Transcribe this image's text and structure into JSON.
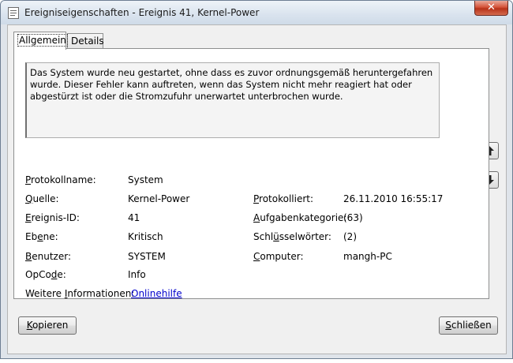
{
  "window": {
    "title": "Ereigniseigenschaften - Ereignis 41, Kernel-Power",
    "close_glyph": "✕"
  },
  "tabs": [
    {
      "label": "Allgemein",
      "active": true
    },
    {
      "label": "Details",
      "active": false
    }
  ],
  "description": "Das System wurde neu gestartet, ohne dass es zuvor ordnungsgemäß heruntergefahren wurde. Dieser Fehler kann auftreten, wenn das System nicht mehr reagiert hat oder abgestürzt ist oder die Stromzufuhr unerwartet unterbrochen wurde.",
  "fields": {
    "protokollname": {
      "label": "Protokollname:",
      "value": "System"
    },
    "quelle": {
      "label": "Quelle:",
      "value": "Kernel-Power"
    },
    "ereignis_id": {
      "label": "Ereignis-ID:",
      "value": "41"
    },
    "ebene": {
      "label": "Ebene:",
      "value": "Kritisch"
    },
    "benutzer": {
      "label": "Benutzer:",
      "value": "SYSTEM"
    },
    "opcode": {
      "label": "OpCode:",
      "value": "Info"
    },
    "weitere": {
      "label": "Weitere Informationen:",
      "link": "Onlinehilfe"
    },
    "protokolliert": {
      "label": "Protokolliert:",
      "value": "26.11.2010 16:55:17"
    },
    "aufgabenkategorie": {
      "label": "Aufgabenkategorie:",
      "value": "(63)"
    },
    "schluesselwoerter": {
      "label": "Schlüsselwörter:",
      "value": "(2)"
    },
    "computer": {
      "label": "Computer:",
      "value": "mangh-PC"
    }
  },
  "buttons": {
    "copy": "Kopieren",
    "close": "Schließen"
  },
  "icons": {
    "up": "arrow-up-icon",
    "down": "arrow-down-icon"
  }
}
